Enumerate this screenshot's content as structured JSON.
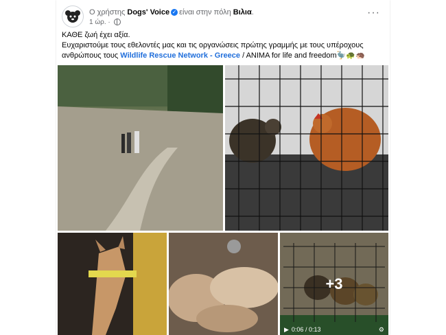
{
  "post": {
    "prefix": "Ο χρήστης",
    "author": "Dogs' Voice",
    "location_text": "είναι στην πόλη",
    "location": "Βιλια",
    "time": "1 ώρ.",
    "more_label": "···",
    "text_line1": "ΚΑΘΕ ζωή έχει αξία.",
    "text_line2_part1": "Ευχαριστούμε τους εθελοντές μας και τις οργανώσεις πρώτης γραμμής με τους υπέροχους ανθρώπους τους",
    "link": "Wildlife Rescue Network - Greece",
    "text_line2_part2": " / ANIMA for life and freedom",
    "emojis": "🦤🐢🦔",
    "more_photos": "+3",
    "video_time": "0:06 / 0:13"
  },
  "colors": {
    "link": "#216fdb",
    "verified": "#1877f2"
  }
}
